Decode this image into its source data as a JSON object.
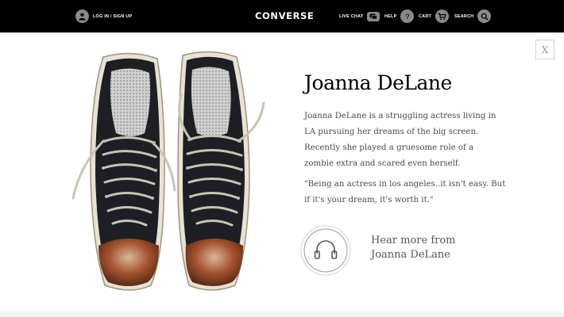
{
  "header": {
    "login_label": "LOG IN / SIGN UP",
    "brand": "CONVERSE",
    "nav": {
      "live_chat": "LIVE CHAT",
      "help": "HELP",
      "cart": "CART",
      "search": "SEARCH"
    },
    "help_glyph": "?"
  },
  "icons": {
    "login": "user-icon",
    "live_chat": "chat-bubble-icon",
    "help": "question-icon",
    "cart": "cart-icon",
    "search": "search-icon",
    "audio": "headphones-icon",
    "close": "close-icon"
  },
  "colors": {
    "topbar": "#000000",
    "icon_circle": "#8a8a8a",
    "body_text": "#4a4a4a",
    "title_text": "#000000"
  },
  "modal": {
    "close_label": "X",
    "profile": {
      "name": "Joanna DeLane",
      "bio": "Joanna DeLane is a struggling actress living in LA pursuing her dreams of the big screen. Recently she played a gruesome role of a zombie extra and scared even herself.",
      "quote": "\"Being an actress in los angeles..it isn't easy. But if it's your dream, it's worth it.\"",
      "audio_cta": "Hear more from Joanna DeLane"
    }
  }
}
